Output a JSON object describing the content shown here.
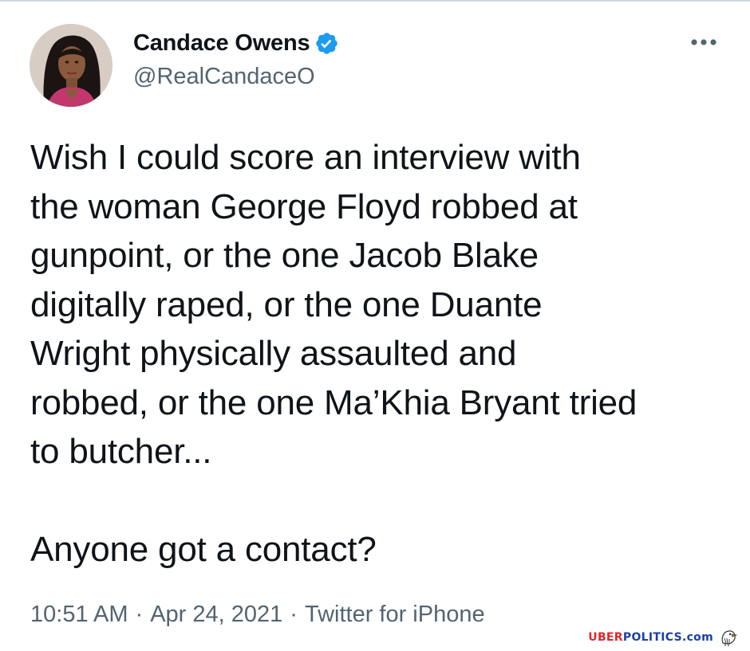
{
  "tweet": {
    "author": {
      "display_name": "Candace Owens",
      "handle": "@RealCandaceO",
      "verified": true,
      "avatar_icon": "profile-photo"
    },
    "text_lines": [
      "Wish I could score an interview with",
      "the woman George Floyd robbed at",
      "gunpoint, or the one Jacob Blake",
      "digitally raped, or the one Duante",
      "Wright physically assaulted and",
      "robbed, or the one Ma’Khia Bryant tried",
      "to butcher..."
    ],
    "followup": "Anyone got a contact?",
    "time": "10:51 AM",
    "separator": "·",
    "date": "Apr 24, 2021",
    "source": "Twitter for iPhone"
  },
  "watermark": {
    "part1": "UBER",
    "part2": "POLITICS",
    "part3": ".com",
    "icon": "eagle-icon"
  },
  "colors": {
    "text": "#0f1419",
    "secondary": "#536471",
    "verified_badge": "#1d9bf0",
    "watermark_red": "#e0262b",
    "watermark_blue": "#1a3fa8"
  },
  "icons": {
    "verified": "verified-badge-icon",
    "more": "more-options-icon"
  }
}
